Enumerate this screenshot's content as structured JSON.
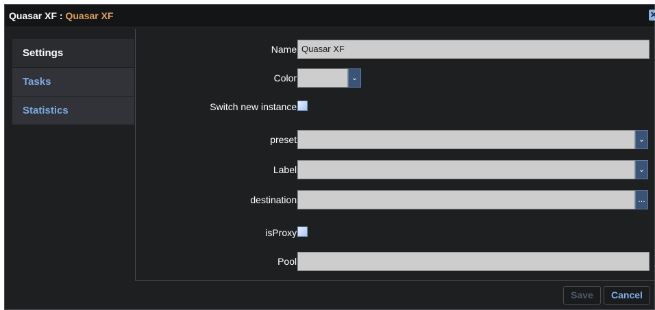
{
  "titlebar": {
    "title_main": "Quasar XF",
    "separator": " : ",
    "title_sub": "Quasar XF",
    "close_icon": "close-icon"
  },
  "sidebar": {
    "items": [
      {
        "label": "Settings"
      },
      {
        "label": "Tasks"
      },
      {
        "label": "Statistics"
      }
    ]
  },
  "form": {
    "name_label": "Name:",
    "name_value": "Quasar XF",
    "color_label": "Color:",
    "switch_label": "Switch new instance:",
    "preset_label": "preset:",
    "label_label": "Label:",
    "destination_label": "destination:",
    "isproxy_label": "isProxy:",
    "pool_label": "Pool:",
    "chevron_glyph": "⌄",
    "browse_glyph": "…"
  },
  "footer": {
    "save_label": "Save",
    "cancel_label": "Cancel"
  },
  "colors": {
    "accent": "#79a9e0",
    "title_sub": "#e3a25c",
    "background": "#1e1f21"
  }
}
